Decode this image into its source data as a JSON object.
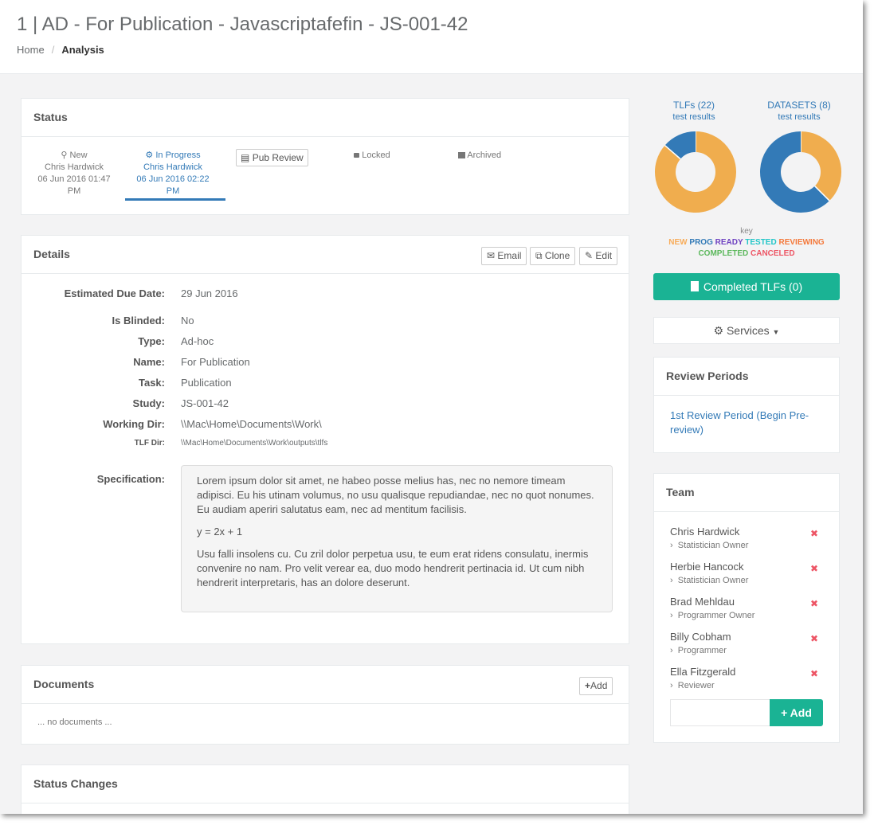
{
  "header": {
    "title": "1 | AD - For Publication - Javascriptafefin - JS-001-42",
    "breadcrumb": {
      "home": "Home",
      "separator": "/",
      "current": "Analysis"
    }
  },
  "status_panel": {
    "title": "Status",
    "steps": [
      {
        "icon": "lightbulb-icon",
        "label": "New",
        "user": "Chris Hardwick",
        "date": "06 Jun 2016 01:47",
        "time": "PM"
      },
      {
        "icon": "gear-icon",
        "label": "In Progress",
        "user": "Chris Hardwick",
        "date": "06 Jun 2016 02:22",
        "time": "PM"
      },
      {
        "icon": "list-icon",
        "label": "Pub Review"
      },
      {
        "icon": "lock-icon",
        "label": "Locked"
      },
      {
        "icon": "archive-icon",
        "label": "Archived"
      }
    ]
  },
  "details_panel": {
    "title": "Details",
    "buttons": {
      "email": "Email",
      "clone": "Clone",
      "edit": "Edit"
    },
    "fields": {
      "due_date": {
        "key": "Estimated Due Date:",
        "value": "29 Jun 2016"
      },
      "blinded": {
        "key": "Is Blinded:",
        "value": "No"
      },
      "type": {
        "key": "Type:",
        "value": "Ad-hoc"
      },
      "name": {
        "key": "Name:",
        "value": "For Publication"
      },
      "task": {
        "key": "Task:",
        "value": "Publication"
      },
      "study": {
        "key": "Study:",
        "value": "JS-001-42"
      },
      "working_dir": {
        "key": "Working Dir:",
        "value": "\\\\Mac\\Home\\Documents\\Work\\"
      },
      "tlf_dir": {
        "key": "TLF Dir:",
        "value": "\\\\Mac\\Home\\Documents\\Work\\outputs\\tlfs"
      },
      "specification": {
        "key": "Specification:"
      }
    },
    "specification": {
      "p1": "Lorem ipsum dolor sit amet, ne habeo posse melius has, nec no nemore timeam adipisci. Eu his utinam volumus, no usu qualisque repudiandae, nec no quot nonumes. Eu audiam aperiri salutatus eam, nec ad mentitum facilisis.",
      "p2": "y = 2x + 1",
      "p3": "Usu falli insolens cu. Cu zril dolor perpetua usu, te eum erat ridens consulatu, inermis convenire no nam. Pro velit verear ea, duo modo hendrerit pertinacia id. Ut cum nibh hendrerit interpretaris, has an dolore deserunt."
    }
  },
  "documents_panel": {
    "title": "Documents",
    "add_label": "Add",
    "empty_text": "... no documents ..."
  },
  "status_changes_panel": {
    "title": "Status Changes"
  },
  "charts": {
    "tlfs": {
      "title": "TLFs (22)",
      "subtitle": "test results"
    },
    "datasets": {
      "title": "DATASETS (8)",
      "subtitle": "test results"
    },
    "key": {
      "label": "key",
      "items": [
        {
          "text": "NEW",
          "color": "#f8ac59"
        },
        {
          "text": "PROG",
          "color": "#337ab7"
        },
        {
          "text": "READY",
          "color": "#6f42c1"
        },
        {
          "text": "TESTED",
          "color": "#23c6c8"
        },
        {
          "text": "REVIEWING",
          "color": "#f4793b"
        },
        {
          "text": "COMPLETED",
          "color": "#5cb85c"
        },
        {
          "text": "CANCELED",
          "color": "#ed5565"
        }
      ]
    }
  },
  "chart_data": [
    {
      "type": "pie",
      "title": "TLFs (22)",
      "subtitle": "test results",
      "categories": [
        "NEW",
        "PROG"
      ],
      "values": [
        19,
        3
      ],
      "colors": [
        "#f0ad4e",
        "#337ab7"
      ]
    },
    {
      "type": "pie",
      "title": "DATASETS (8)",
      "subtitle": "test results",
      "categories": [
        "NEW",
        "PROG"
      ],
      "values": [
        3,
        5
      ],
      "colors": [
        "#f0ad4e",
        "#337ab7"
      ]
    }
  ],
  "actions": {
    "completed_tlfs": "Completed TLFs (0)",
    "services": "Services"
  },
  "review_periods": {
    "title": "Review Periods",
    "link": "1st Review Period (Begin Pre-review)"
  },
  "team": {
    "title": "Team",
    "members": [
      {
        "name": "Chris Hardwick",
        "role": "Statistician Owner"
      },
      {
        "name": "Herbie Hancock",
        "role": "Statistician Owner"
      },
      {
        "name": "Brad Mehldau",
        "role": "Programmer Owner"
      },
      {
        "name": "Billy Cobham",
        "role": "Programmer"
      },
      {
        "name": "Ella Fitzgerald",
        "role": "Reviewer"
      }
    ],
    "add_label": "Add",
    "input_placeholder": ""
  }
}
